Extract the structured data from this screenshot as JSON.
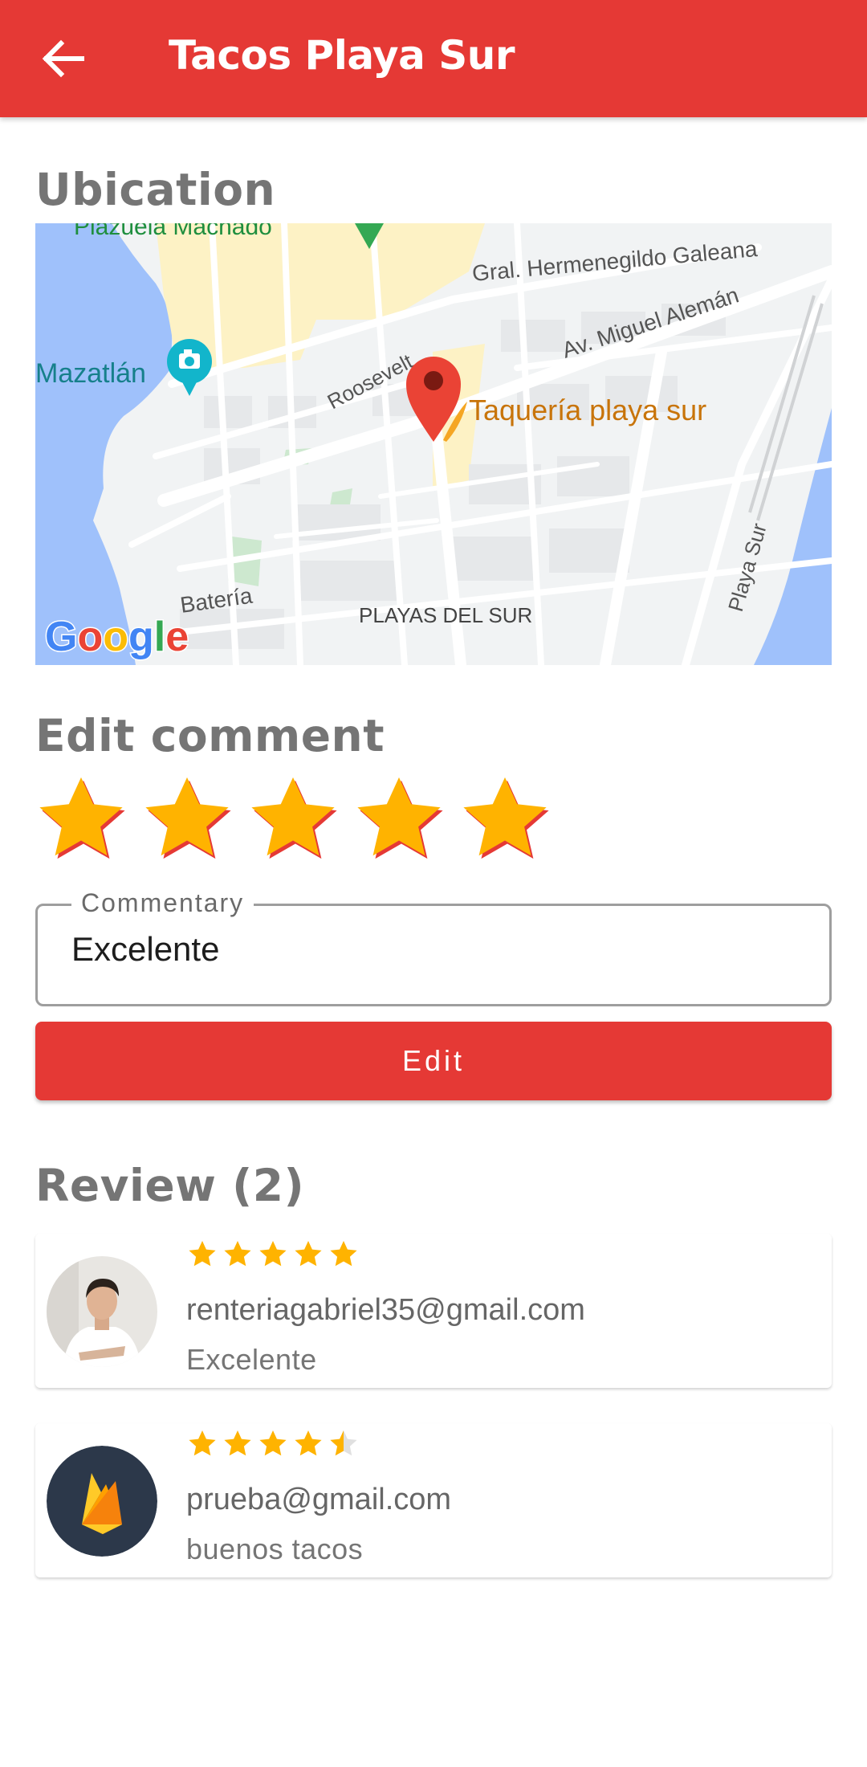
{
  "appbar": {
    "title": "Tacos Playa Sur",
    "back_icon": "arrow-back-icon"
  },
  "ubication": {
    "title": "Ubication",
    "map": {
      "labels": {
        "plazuela": "Plazuela Machado",
        "galeana": "Gral. Hermenegildo Galeana",
        "aleman": "Av. Miguel Alemán",
        "mazatlan": "Mazatlán",
        "roosevelt": "Roosevelt",
        "place": "Taquería playa sur",
        "playa_sur": "Playa Sur",
        "bateria": "Batería",
        "playas_del_sur": "PLAYAS DEL SUR"
      },
      "logo": "Google",
      "colors": {
        "water": "#9fc1fb",
        "land": "#f1f3f4",
        "road": "#ffffff",
        "sand": "#fdf2c5",
        "pin": "#ea4335",
        "place_label": "#c8740a"
      }
    }
  },
  "edit_comment": {
    "title": "Edit comment",
    "rating": 5,
    "max_rating": 5,
    "commentary_label": "Commentary",
    "commentary_value": "Excelente",
    "button_label": "Edit"
  },
  "reviews": {
    "title": "Review (2)",
    "items": [
      {
        "email": "renteriagabriel35@gmail.com",
        "comment": "Excelente",
        "rating": 5,
        "avatar": "person-photo"
      },
      {
        "email": "prueba@gmail.com",
        "comment": "buenos tacos",
        "rating": 4.5,
        "avatar": "firebase-logo"
      }
    ]
  },
  "colors": {
    "primary": "#e53935",
    "star": "#ffb300",
    "star_shadow": "#e53935"
  }
}
